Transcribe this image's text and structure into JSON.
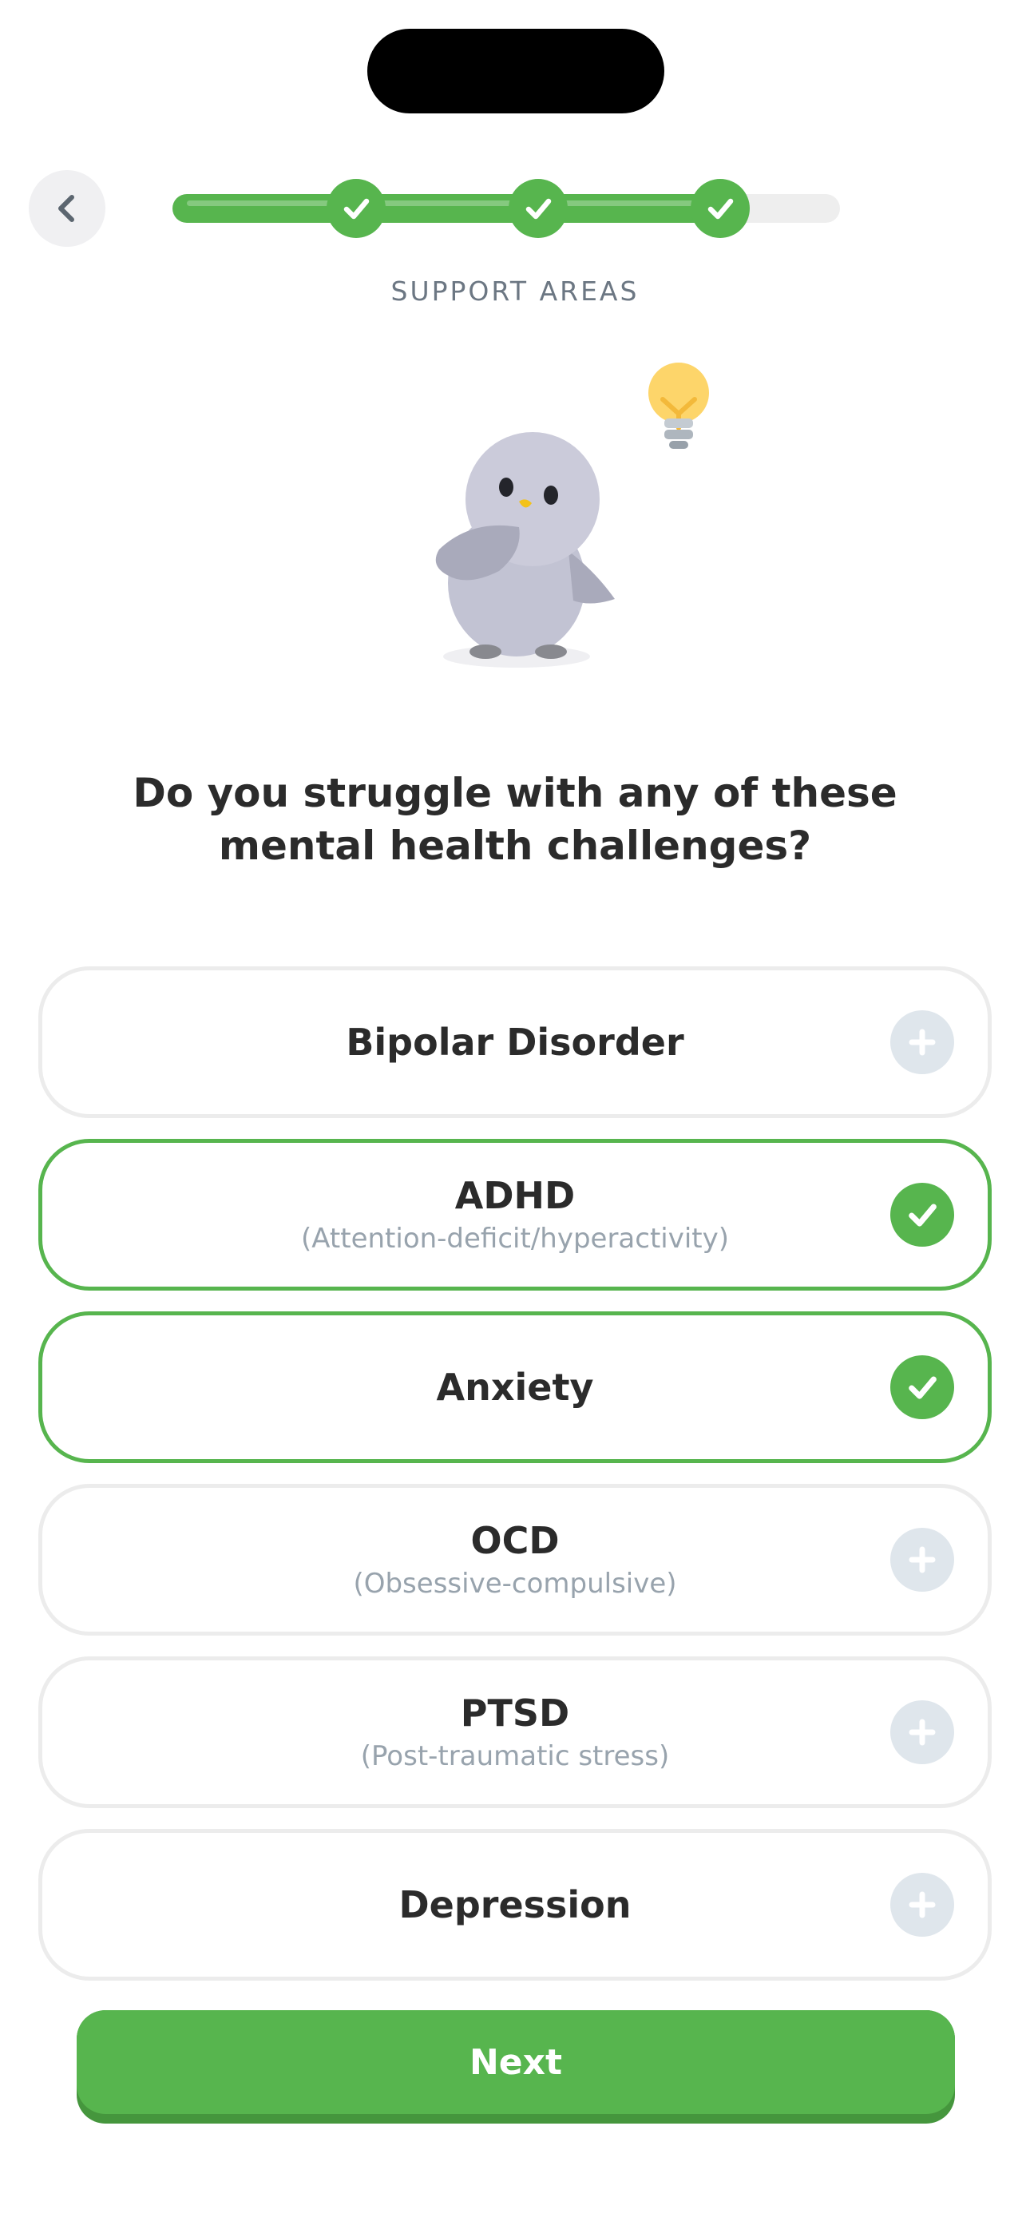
{
  "header": {
    "section_label": "SUPPORT AREAS",
    "back_icon": "chevron-left-icon",
    "progress": {
      "fraction_complete": 0.82,
      "completed_steps": 3,
      "step_icon": "check-icon"
    }
  },
  "question": "Do you struggle with any of these mental health challenges?",
  "options": [
    {
      "title": "Bipolar Disorder",
      "subtitle": "",
      "selected": false,
      "icon": "plus-icon"
    },
    {
      "title": "ADHD",
      "subtitle": "(Attention-deficit/hyperactivity)",
      "selected": true,
      "icon": "check-icon"
    },
    {
      "title": "Anxiety",
      "subtitle": "",
      "selected": true,
      "icon": "check-icon"
    },
    {
      "title": "OCD",
      "subtitle": "(Obsessive-compulsive)",
      "selected": false,
      "icon": "plus-icon"
    },
    {
      "title": "PTSD",
      "subtitle": "(Post-traumatic stress)",
      "selected": false,
      "icon": "plus-icon"
    },
    {
      "title": "Depression",
      "subtitle": "",
      "selected": false,
      "icon": "plus-icon"
    }
  ],
  "next_button": {
    "label": "Next"
  },
  "colors": {
    "accent_green": "#57b54e",
    "accent_green_dark": "#45963d",
    "unselected_icon_bg": "#dfe6ec",
    "label_gray": "#6c7783",
    "subtitle_gray": "#98a3ad"
  }
}
